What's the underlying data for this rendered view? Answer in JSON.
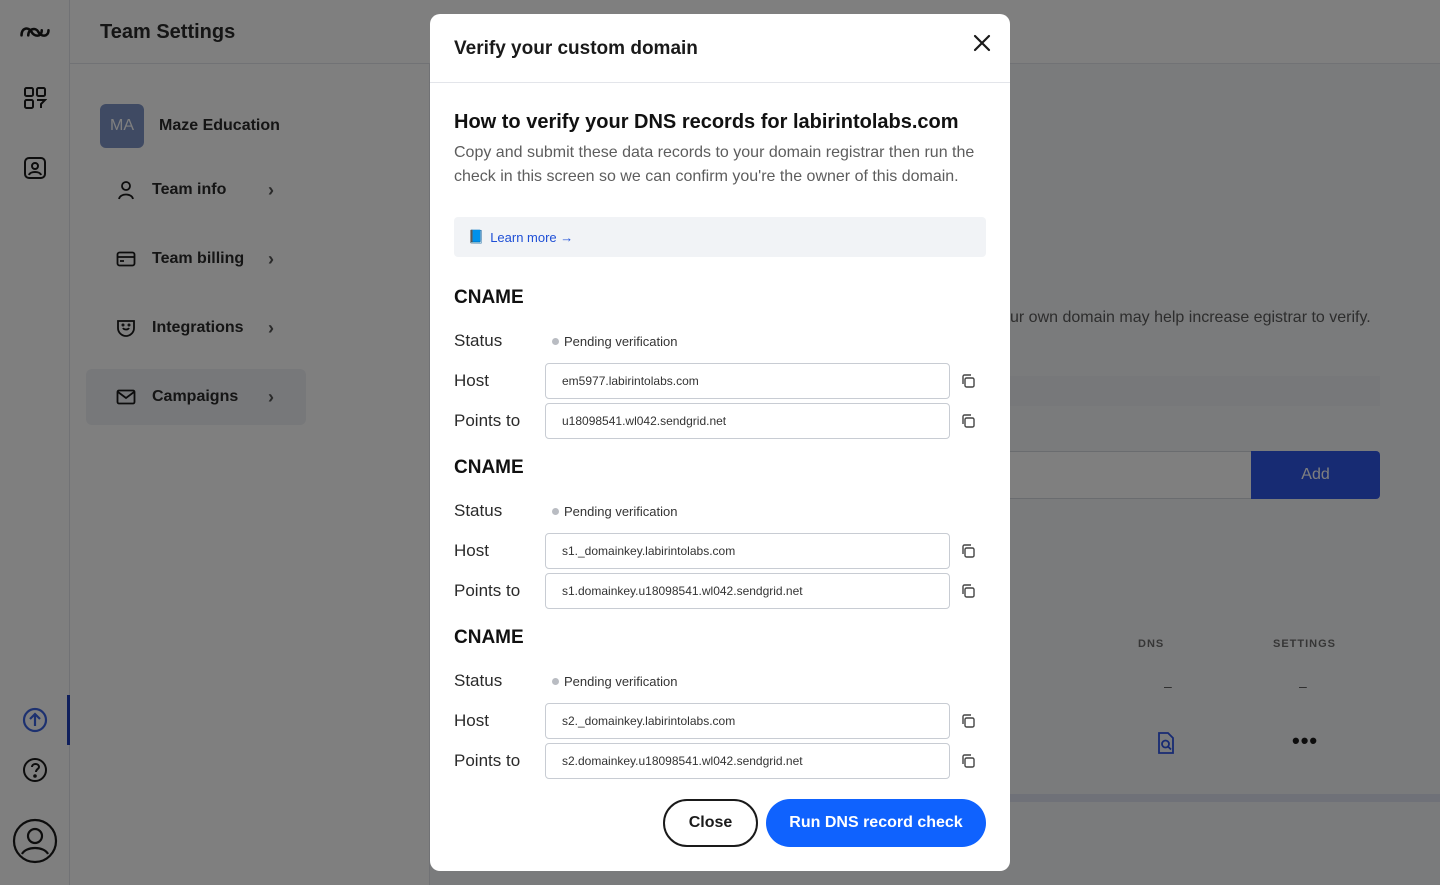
{
  "app": {
    "page_title": "Team Settings",
    "team": {
      "avatar_initials": "MA",
      "name": "Maze Education"
    },
    "nav": [
      {
        "label": "Team info",
        "icon": "person-icon"
      },
      {
        "label": "Team billing",
        "icon": "card-icon"
      },
      {
        "label": "Integrations",
        "icon": "plug-icon"
      },
      {
        "label": "Campaigns",
        "icon": "mail-icon"
      }
    ],
    "background_text": "ur own domain may help increase egistrar to verify.",
    "add_label": "Add",
    "table_headers": {
      "dns": "DNS",
      "settings": "SETTINGS"
    },
    "dash": "–"
  },
  "modal": {
    "title": "Verify your custom domain",
    "heading": "How to verify your DNS records for labirintolabs.com",
    "description": "Copy and submit these data records to your domain registrar then run the check in this screen so we can confirm you're the owner of this domain.",
    "learn_more": "Learn more →",
    "records": [
      {
        "type": "CNAME",
        "status_label": "Status",
        "status": "Pending verification",
        "host_label": "Host",
        "host": "em5977.labirintolabs.com",
        "points_label": "Points to",
        "points_to": "u18098541.wl042.sendgrid.net"
      },
      {
        "type": "CNAME",
        "status_label": "Status",
        "status": "Pending verification",
        "host_label": "Host",
        "host": "s1._domainkey.labirintolabs.com",
        "points_label": "Points to",
        "points_to": "s1.domainkey.u18098541.wl042.sendgrid.net"
      },
      {
        "type": "CNAME",
        "status_label": "Status",
        "status": "Pending verification",
        "host_label": "Host",
        "host": "s2._domainkey.labirintolabs.com",
        "points_label": "Points to",
        "points_to": "s2.domainkey.u18098541.wl042.sendgrid.net"
      }
    ],
    "close_label": "Close",
    "run_label": "Run DNS record check"
  },
  "colors": {
    "primary": "#0f62fe",
    "overlay": "rgba(0,0,0,0.5)",
    "pending_dot": "#b9bcc2"
  }
}
